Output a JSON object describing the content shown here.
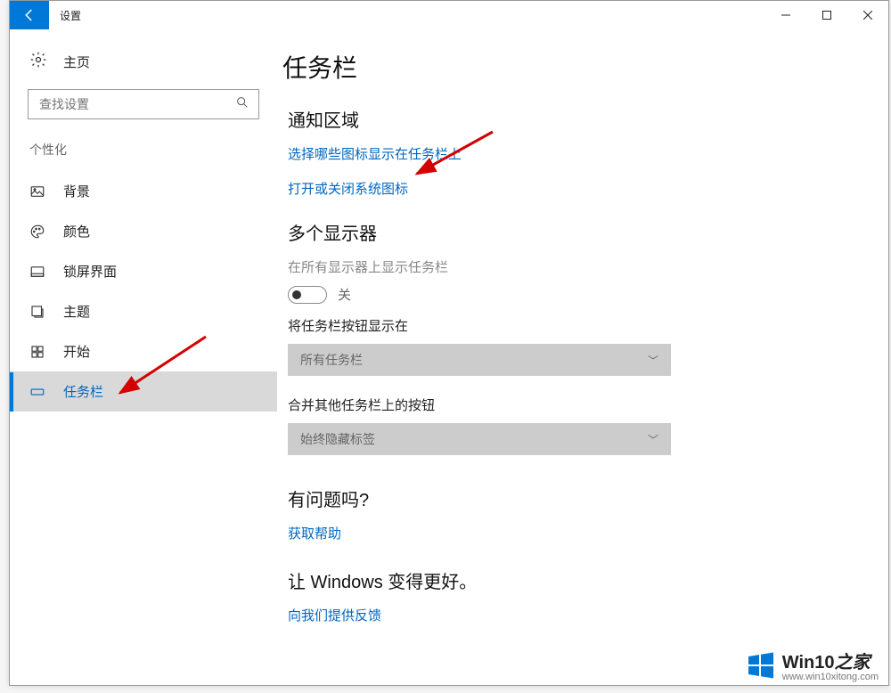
{
  "titlebar": {
    "title": "设置"
  },
  "sidebar": {
    "home": "主页",
    "search_placeholder": "查找设置",
    "group": "个性化",
    "items": [
      {
        "label": "背景"
      },
      {
        "label": "颜色"
      },
      {
        "label": "锁屏界面"
      },
      {
        "label": "主题"
      },
      {
        "label": "开始"
      },
      {
        "label": "任务栏"
      }
    ]
  },
  "content": {
    "page_title": "任务栏",
    "notify_header": "通知区域",
    "link_icons": "选择哪些图标显示在任务栏上",
    "link_system_icons": "打开或关闭系统图标",
    "multi_header": "多个显示器",
    "multi_show_label": "在所有显示器上显示任务栏",
    "toggle_off": "关",
    "show_buttons_label": "将任务栏按钮显示在",
    "dropdown_all": "所有任务栏",
    "combine_label": "合并其他任务栏上的按钮",
    "dropdown_hide": "始终隐藏标签",
    "help_header": "有问题吗?",
    "help_link": "获取帮助",
    "feedback_header": "让 Windows 变得更好。",
    "feedback_link": "向我们提供反馈"
  },
  "watermark": {
    "title_en": "Win10",
    "title_zh": "之家",
    "url": "www.win10xitong.com"
  }
}
